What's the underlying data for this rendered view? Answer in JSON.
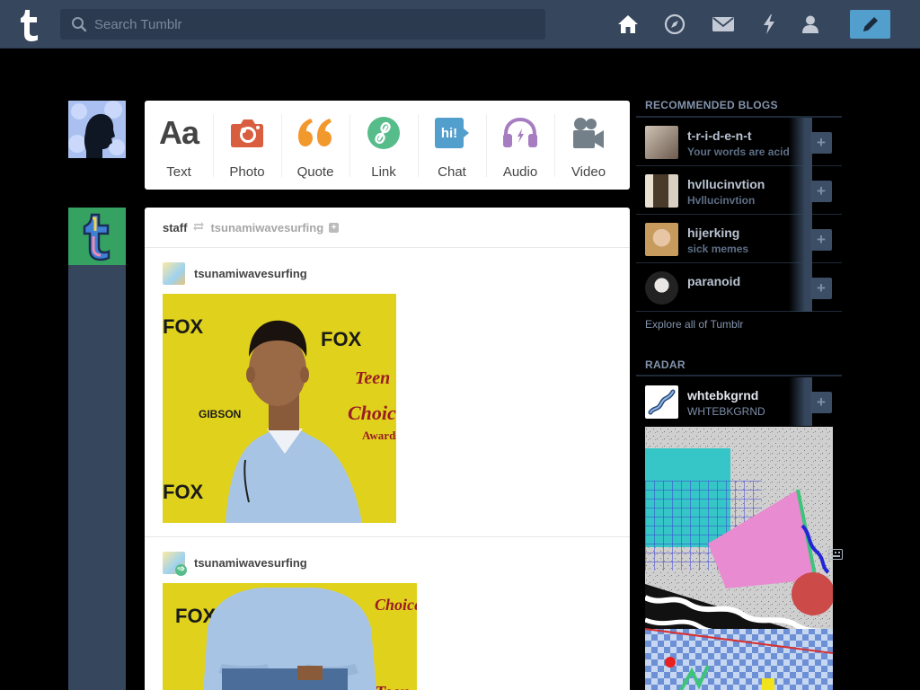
{
  "header": {
    "search_placeholder": "Search Tumblr",
    "nav_icons": [
      "home-icon",
      "explore-icon",
      "inbox-icon",
      "activity-icon",
      "account-icon"
    ],
    "compose_icon": "pencil-icon",
    "colors": {
      "bar": "#36465d",
      "search": "#2b3a4f",
      "compose": "#529ecc"
    }
  },
  "post_types": [
    {
      "name": "text",
      "label": "Text",
      "color": "#444444"
    },
    {
      "name": "photo",
      "label": "Photo",
      "color": "#d95e40"
    },
    {
      "name": "quote",
      "label": "Quote",
      "color": "#f2992e"
    },
    {
      "name": "link",
      "label": "Link",
      "color": "#56bc8a"
    },
    {
      "name": "chat",
      "label": "Chat",
      "color": "#529ecc"
    },
    {
      "name": "audio",
      "label": "Audio",
      "color": "#a77dc2"
    },
    {
      "name": "video",
      "label": "Video",
      "color": "#748089"
    }
  ],
  "post": {
    "author": "staff",
    "reblogged_from": "tsunamiwavesurfing",
    "entries": [
      {
        "name": "tsunamiwavesurfing",
        "image": "photo-man-event-backdrop"
      },
      {
        "name": "tsunamiwavesurfing",
        "image": "photo-man-event-backdrop-2"
      }
    ],
    "fox_text": "FOX",
    "gibson_text": "GIBSON",
    "teen_text": "Teen",
    "choice_text": "Choice",
    "awards_text": "Awards"
  },
  "sidebar": {
    "recommended_title": "RECOMMENDED BLOGS",
    "recommended": [
      {
        "name": "t-r-i-d-e-n-t",
        "subtitle": "Your words are acid"
      },
      {
        "name": "hvllucinvtion",
        "subtitle": "Hvllucinvtion"
      },
      {
        "name": "hijerking",
        "subtitle": "sick memes"
      },
      {
        "name": "paranoid",
        "subtitle": ""
      }
    ],
    "follow_label": "+",
    "explore_link": "Explore all of Tumblr",
    "radar_title": "RADAR",
    "radar": {
      "name": "whtebkgrnd",
      "subtitle": "WHTEBKGRND"
    }
  }
}
